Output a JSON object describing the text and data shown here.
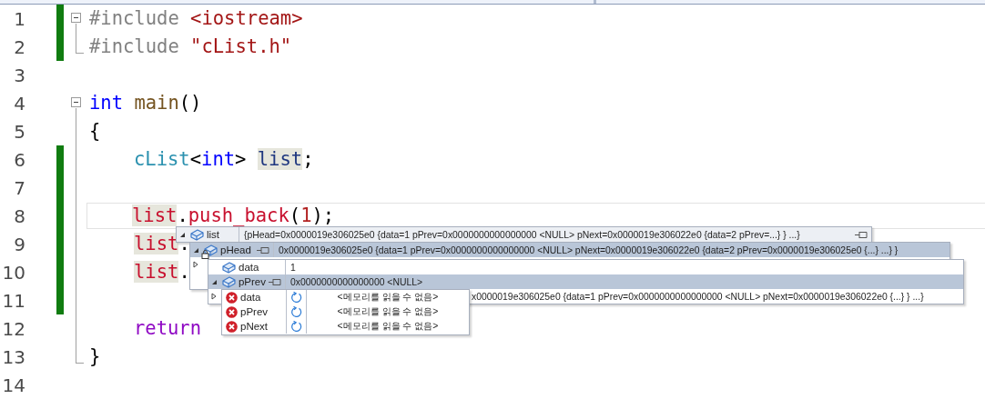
{
  "editor": {
    "lines": [
      {
        "number": "1",
        "changed": true,
        "current": false,
        "kind": "open",
        "indented": false,
        "tokens": [
          {
            "kind": "preproc",
            "text": "#include ",
            "highlighted": false
          },
          {
            "kind": "include",
            "text": "<iostream>",
            "highlighted": false
          }
        ]
      },
      {
        "number": "2",
        "changed": true,
        "current": false,
        "kind": "end",
        "indented": false,
        "tokens": [
          {
            "kind": "preproc",
            "text": "#include ",
            "highlighted": false
          },
          {
            "kind": "include",
            "text": "\"cList.h\"",
            "highlighted": false
          }
        ]
      },
      {
        "number": "3",
        "changed": false,
        "current": false,
        "kind": "none"
      },
      {
        "number": "4",
        "changed": false,
        "current": false,
        "kind": "open",
        "indented": false,
        "tokens": [
          {
            "kind": "keyword",
            "text": "int ",
            "highlighted": false
          },
          {
            "kind": "function",
            "text": "main",
            "highlighted": false
          },
          {
            "kind": "plain",
            "text": "()",
            "highlighted": false
          }
        ]
      },
      {
        "number": "5",
        "changed": false,
        "current": false,
        "kind": "line",
        "indented": false,
        "tokens": [
          {
            "kind": "plain",
            "text": "{",
            "highlighted": false
          }
        ]
      },
      {
        "number": "6",
        "changed": true,
        "current": false,
        "kind": "line",
        "indented": true,
        "tokens": [
          {
            "kind": "type",
            "text": "cList",
            "highlighted": false
          },
          {
            "kind": "plain",
            "text": "<",
            "highlighted": false
          },
          {
            "kind": "keyword",
            "text": "int",
            "highlighted": false
          },
          {
            "kind": "plain",
            "text": "> ",
            "highlighted": false
          },
          {
            "kind": "variable",
            "text": "list",
            "highlighted": true
          },
          {
            "kind": "plain",
            "text": ";",
            "highlighted": false
          }
        ]
      },
      {
        "number": "7",
        "changed": true,
        "current": false,
        "kind": "line"
      },
      {
        "number": "8",
        "changed": true,
        "current": true,
        "kind": "line",
        "indented": true,
        "tokens": [
          {
            "kind": "local",
            "text": "list",
            "highlighted": true
          },
          {
            "kind": "plain",
            "text": ".",
            "highlighted": false
          },
          {
            "kind": "local",
            "text": "push_back",
            "highlighted": false
          },
          {
            "kind": "plain",
            "text": "(",
            "highlighted": false
          },
          {
            "kind": "number",
            "text": "1",
            "highlighted": false
          },
          {
            "kind": "plain",
            "text": ");",
            "highlighted": false
          }
        ]
      },
      {
        "number": "9",
        "changed": true,
        "current": false,
        "kind": "line",
        "indented": true,
        "tokens": [
          {
            "kind": "local",
            "text": "list",
            "highlighted": true
          },
          {
            "kind": "plain",
            "text": ".",
            "highlighted": false
          }
        ]
      },
      {
        "number": "10",
        "changed": true,
        "current": false,
        "kind": "line",
        "indented": true,
        "tokens": [
          {
            "kind": "local",
            "text": "list",
            "highlighted": true
          },
          {
            "kind": "plain",
            "text": ".",
            "highlighted": false
          }
        ]
      },
      {
        "number": "11",
        "changed": true,
        "current": false,
        "kind": "line"
      },
      {
        "number": "12",
        "changed": false,
        "current": false,
        "kind": "line",
        "indented": true,
        "tokens": [
          {
            "kind": "control",
            "text": "return",
            "highlighted": false
          }
        ]
      },
      {
        "number": "13",
        "changed": false,
        "current": false,
        "kind": "end",
        "indented": false,
        "tokens": [
          {
            "kind": "plain",
            "text": "}",
            "highlighted": false
          }
        ]
      },
      {
        "number": "14",
        "changed": false,
        "current": false,
        "kind": "none"
      }
    ]
  },
  "datatips": [
    {
      "rows": [
        {
          "kind": "full",
          "expandable": true,
          "expanded": true,
          "name": "list",
          "value": "{pHead=0x0000019e306025e0 {data=1 pPrev=0x0000000000000000 <NULL> pNext=0x0000019e306022e0 {data=2 pPrev=...} } ...}",
          "pinnable": true,
          "locked": false,
          "selected": false
        }
      ]
    },
    {
      "rows": [
        {
          "kind": "full",
          "expandable": true,
          "expanded": true,
          "name": "pHead",
          "value": "0x0000019e306025e0 {data=1 pPrev=0x0000000000000000 <NULL> pNext=0x0000019e306022e0 {data=2 pPrev=0x0000019e306025e0 {...} ...} }",
          "pinnable": true,
          "locked": true,
          "selected": true
        },
        {
          "kind": "stub",
          "expandable": true,
          "expanded": false
        }
      ]
    },
    {
      "rows": [
        {
          "kind": "full",
          "expandable": false,
          "name": "data",
          "value": "1",
          "pinnable": false,
          "locked": false,
          "selected": false
        },
        {
          "kind": "full",
          "expandable": true,
          "expanded": true,
          "name": "pPrev",
          "value": "0x0000000000000000 <NULL>",
          "pinnable": true,
          "locked": false,
          "selected": true
        },
        {
          "kind": "tail",
          "expandable": true,
          "expanded": false,
          "value": "x0000019e306025e0 {data=1 pPrev=0x0000000000000000 <NULL> pNext=0x0000019e306022e0 {...} } ...}"
        }
      ]
    },
    {
      "rows": [
        {
          "kind": "error",
          "name": "data",
          "value": "<메모리를 읽을 수 없음>"
        },
        {
          "kind": "error",
          "name": "pPrev",
          "value": "<메모리를 읽을 수 없음>"
        },
        {
          "kind": "error",
          "name": "pNext",
          "value": "<메모리를 읽을 수 없음>"
        }
      ]
    }
  ]
}
